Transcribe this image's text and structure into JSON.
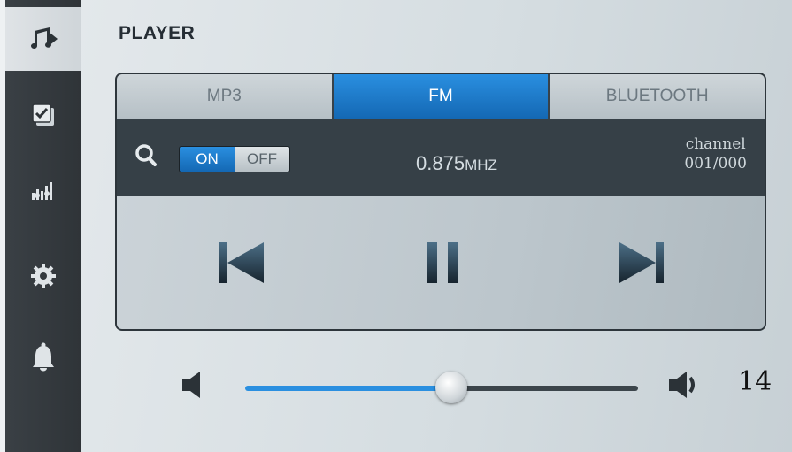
{
  "sidebar": {
    "items": [
      {
        "icon": "music-player-icon",
        "active": true
      },
      {
        "icon": "checklist-icon",
        "active": false
      },
      {
        "icon": "equalizer-icon",
        "active": false
      },
      {
        "icon": "gear-icon",
        "active": false
      },
      {
        "icon": "bell-icon",
        "active": false
      }
    ]
  },
  "header": {
    "title": "PLAYER"
  },
  "tabs": [
    {
      "label": "MP3",
      "active": false
    },
    {
      "label": "FM",
      "active": true
    },
    {
      "label": "BLUETOOTH",
      "active": false
    }
  ],
  "search": {
    "icon": "search-icon",
    "toggle": {
      "on_label": "ON",
      "off_label": "OFF",
      "state": "ON"
    }
  },
  "frequency": {
    "value": "0.875",
    "unit": "MHZ"
  },
  "channel": {
    "label": "channel",
    "value": "001/000"
  },
  "controls": {
    "prev_icon": "skip-previous-icon",
    "pause_icon": "pause-icon",
    "next_icon": "skip-next-icon"
  },
  "volume": {
    "value": "14",
    "level_fraction": 0.525
  },
  "colors": {
    "accent": "#1e7fd0",
    "sidebar": "#33393e",
    "card": "#364047"
  }
}
